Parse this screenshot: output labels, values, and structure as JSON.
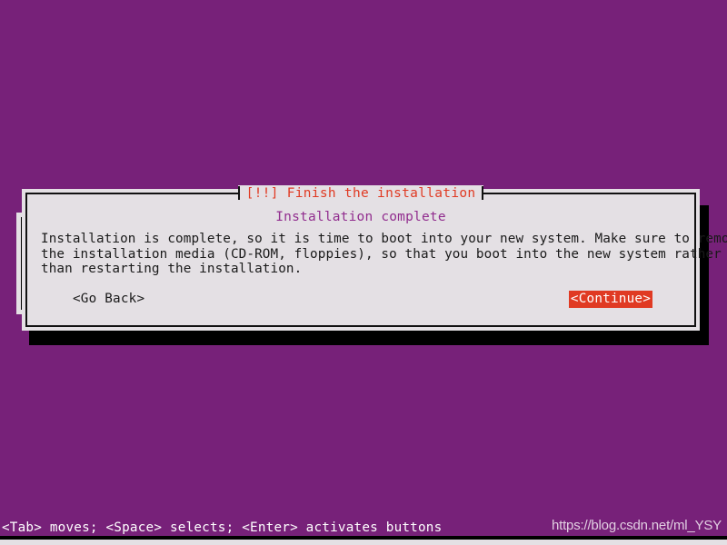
{
  "screen": {
    "background_color": "#772179",
    "dialog_background_color": "#e4e0e4",
    "accent_red": "#e03a23",
    "heading_purple": "#912d8e"
  },
  "dialog": {
    "title": "[!!] Finish the installation",
    "heading": "Installation complete",
    "body": "Installation is complete, so it is time to boot into your new system. Make sure to remove\nthe installation media (CD-ROM, floppies), so that you boot into the new system rather\nthan restarting the installation.",
    "buttons": {
      "go_back": "<Go Back>",
      "continue": "<Continue>"
    }
  },
  "statusbar": {
    "hint": "<Tab> moves; <Space> selects; <Enter> activates buttons"
  },
  "watermark": {
    "text": "https://blog.csdn.net/ml_YSY"
  }
}
